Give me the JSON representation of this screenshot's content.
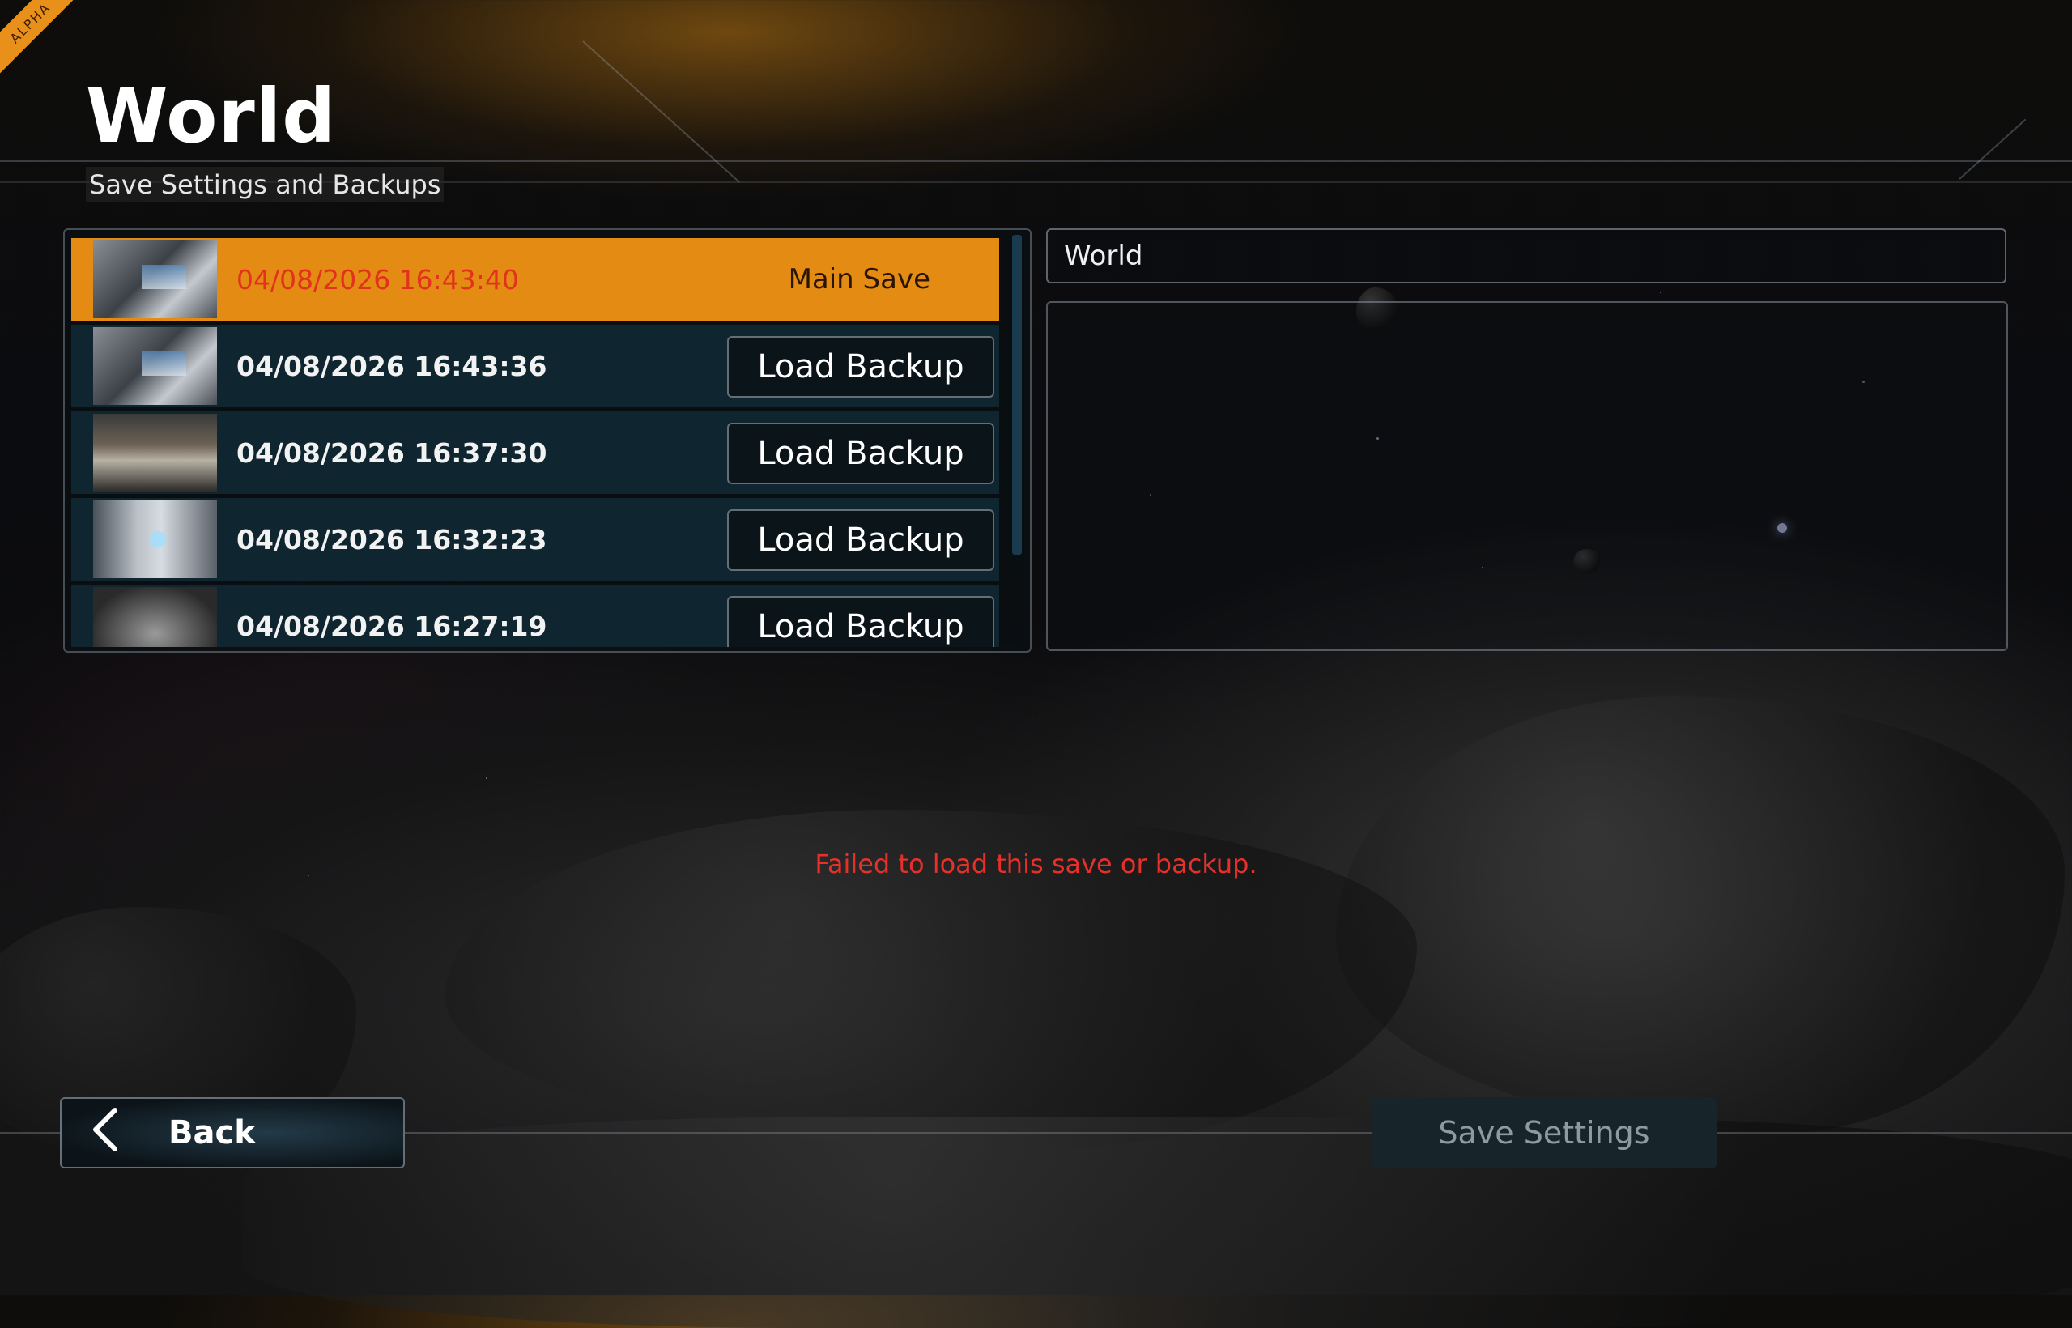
{
  "badge": "ALPHA",
  "header": {
    "title": "World",
    "subtitle": "Save Settings and Backups"
  },
  "saves": [
    {
      "timestamp": "04/08/2026 16:43:40",
      "label": "Main Save",
      "selected": true
    },
    {
      "timestamp": "04/08/2026 16:43:36",
      "action": "Load Backup"
    },
    {
      "timestamp": "04/08/2026 16:37:30",
      "action": "Load Backup"
    },
    {
      "timestamp": "04/08/2026 16:32:23",
      "action": "Load Backup"
    },
    {
      "timestamp": "04/08/2026 16:27:19",
      "action": "Load Backup"
    }
  ],
  "world": {
    "name": "World",
    "description": ""
  },
  "error_message": "Failed to load this save or backup.",
  "footer": {
    "back_label": "Back",
    "save_settings_label": "Save Settings"
  },
  "colors": {
    "accent": "#e48b14",
    "error": "#e8302a",
    "row_bg": "#0f2530"
  }
}
